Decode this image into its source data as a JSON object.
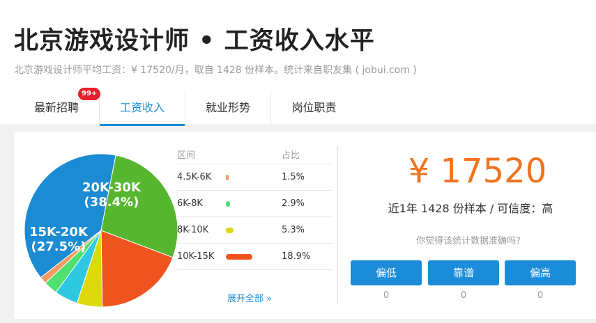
{
  "header": {
    "title": "北京游戏设计师 • 工资收入水平",
    "subtitle": "北京游戏设计师平均工资：¥ 17520/月，取自 1428 份样本。统计来自职友集 ( jobui.com )"
  },
  "tabs": [
    {
      "label": "最新招聘",
      "badge": "99+"
    },
    {
      "label": "工资收入",
      "active": true
    },
    {
      "label": "就业形势"
    },
    {
      "label": "岗位职责"
    }
  ],
  "chart_data": {
    "type": "pie",
    "slices": [
      {
        "label": "20K-30K",
        "value": 38.4,
        "color": "#1b8bd3",
        "display": "(38.4%)"
      },
      {
        "label": "15K-20K",
        "value": 27.5,
        "color": "#57b62f",
        "display": "(27.5%)"
      },
      {
        "label": "10K-15K",
        "value": 18.9,
        "color": "#f0541e"
      },
      {
        "label": "8K-10K",
        "value": 5.3,
        "color": "#dcd80a"
      },
      {
        "label": "",
        "value": 4.9,
        "color": "#2ec8e0"
      },
      {
        "label": "6K-8K",
        "value": 2.9,
        "color": "#4fdf6f"
      },
      {
        "label": "4.5K-6K",
        "value": 1.5,
        "color": "#f59a62"
      }
    ]
  },
  "legend": {
    "col_range": "区间",
    "col_share": "占比",
    "rows": [
      {
        "range": "4.5K-6K",
        "share": "1.5%",
        "value": 1.5,
        "color": "#f59a62"
      },
      {
        "range": "6K-8K",
        "share": "2.9%",
        "value": 2.9,
        "color": "#4fdf6f"
      },
      {
        "range": "8K-10K",
        "share": "5.3%",
        "value": 5.3,
        "color": "#dcd80a"
      },
      {
        "range": "10K-15K",
        "share": "18.9%",
        "value": 18.9,
        "color": "#f0541e"
      }
    ],
    "more": "展开全部 »"
  },
  "summary": {
    "salary": "¥ 17520",
    "meta": "近1年 1428 份样本 / 可信度：高",
    "question": "你觉得该统计数据准确吗？"
  },
  "votes": [
    {
      "label": "偏低",
      "count": "0"
    },
    {
      "label": "靠谱",
      "count": "0"
    },
    {
      "label": "偏高",
      "count": "0"
    }
  ]
}
